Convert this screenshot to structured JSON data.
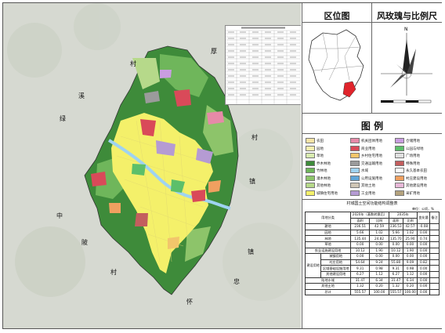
{
  "panels": {
    "location_title": "区位图",
    "rose_title": "风玫瑰与比例尺",
    "legend_title": "图 例",
    "north_letter": "N"
  },
  "map_labels": [
    "村",
    "厚",
    "溪",
    "村",
    "绿",
    "镇",
    "中",
    "陂",
    "忠",
    "村",
    "怀",
    "镇"
  ],
  "legend": [
    {
      "label": "农田",
      "color": "#f6e4a6"
    },
    {
      "label": "园地",
      "color": "#f7efb0"
    },
    {
      "label": "草地",
      "color": "#d9ecb0"
    },
    {
      "label": "乔木林地",
      "color": "#3e8b3a"
    },
    {
      "label": "竹林地",
      "color": "#6fb65b"
    },
    {
      "label": "灌木林地",
      "color": "#8dc46a"
    },
    {
      "label": "其他林地",
      "color": "#b6d98a"
    },
    {
      "label": "城镇住宅用地",
      "color": "#f4f06a"
    },
    {
      "label": "机关团体用地",
      "color": "#e68aa8"
    },
    {
      "label": "商业用地",
      "color": "#d94a59"
    },
    {
      "label": "乡村住宅用地",
      "color": "#f2c66b"
    },
    {
      "label": "交通运输用地",
      "color": "#9b9b9b"
    },
    {
      "label": "水域",
      "color": "#9fd3f1"
    },
    {
      "label": "公用设施用地",
      "color": "#5fa6d8"
    },
    {
      "label": "其他土地",
      "color": "#cfc6b5"
    },
    {
      "label": "工业用地",
      "color": "#b59bd3"
    },
    {
      "label": "仓储用地",
      "color": "#c99de0"
    },
    {
      "label": "公园与绿地",
      "color": "#5cbf6a"
    },
    {
      "label": "广场用地",
      "color": "#e0e0e0"
    },
    {
      "label": "特殊用地",
      "color": "#c35e5e"
    },
    {
      "label": "永久基本农田",
      "color": "#ffffff"
    },
    {
      "label": "村庄建设用地",
      "color": "#f0a060"
    },
    {
      "label": "其他建设用地",
      "color": "#e8b8d8"
    },
    {
      "label": "采矿用地",
      "color": "#b4a27c"
    }
  ],
  "table": {
    "title": "村城国土空间功能结构调整表",
    "unit": "单位：公顷，%",
    "headers": {
      "category": "用地分类",
      "base": "2020年（基数转换后）",
      "target": "2035年",
      "area": "面积",
      "ratio": "比例",
      "change": "变化量",
      "note": "备注"
    },
    "rows": [
      {
        "name": "耕地",
        "a1": "236.51",
        "r1": "42.59",
        "a2": "236.53",
        "r2": "42.57",
        "c": "-0.08"
      },
      {
        "name": "园地",
        "a1": "5.66",
        "r1": "1.02",
        "a2": "5.66",
        "r2": "1.02",
        "c": "0.00"
      },
      {
        "name": "林地",
        "a1": "135.44",
        "r1": "24.82",
        "a2": "135.70",
        "r2": "25.90",
        "c": "0.74"
      },
      {
        "name": "草地",
        "a1": "0.00",
        "r1": "0.00",
        "a2": "0.00",
        "r2": "0.00",
        "c": "0.00"
      },
      {
        "name": "农业设施建设用地",
        "a1": "10.12",
        "r1": "1.90",
        "a2": "10.12",
        "r2": "1.90",
        "c": "0.00"
      },
      {
        "name": "城镇用地",
        "a1": "0.00",
        "r1": "0.00",
        "a2": "0.00",
        "r2": "0.00",
        "c": "0.00"
      },
      {
        "name": "村庄用地",
        "a1": "54.64",
        "r1": "9.24",
        "a2": "55.80",
        "r2": "9.09",
        "c": "0.82"
      },
      {
        "name": "区域基础设施用地",
        "a1": "9.31",
        "r1": "0.98",
        "a2": "9.31",
        "r2": "0.98",
        "c": "0.00"
      },
      {
        "name": "其他建设用地",
        "a1": "6.27",
        "r1": "1.12",
        "a2": "6.27",
        "r2": "1.12",
        "c": "0.00"
      },
      {
        "name": "陆地水域",
        "a1": "31.47",
        "r1": "6.34",
        "a2": "31.47",
        "r2": "6.34",
        "c": "0.00"
      },
      {
        "name": "其他土地",
        "a1": "1.32",
        "r1": "0.20",
        "a2": "1.32",
        "r2": "0.20",
        "c": "0.00"
      },
      {
        "name": "总计",
        "a1": "555.57",
        "r1": "100.00",
        "a2": "555.57",
        "r2": "100.00",
        "c": "0.00"
      }
    ],
    "group_label": "建设用地"
  }
}
